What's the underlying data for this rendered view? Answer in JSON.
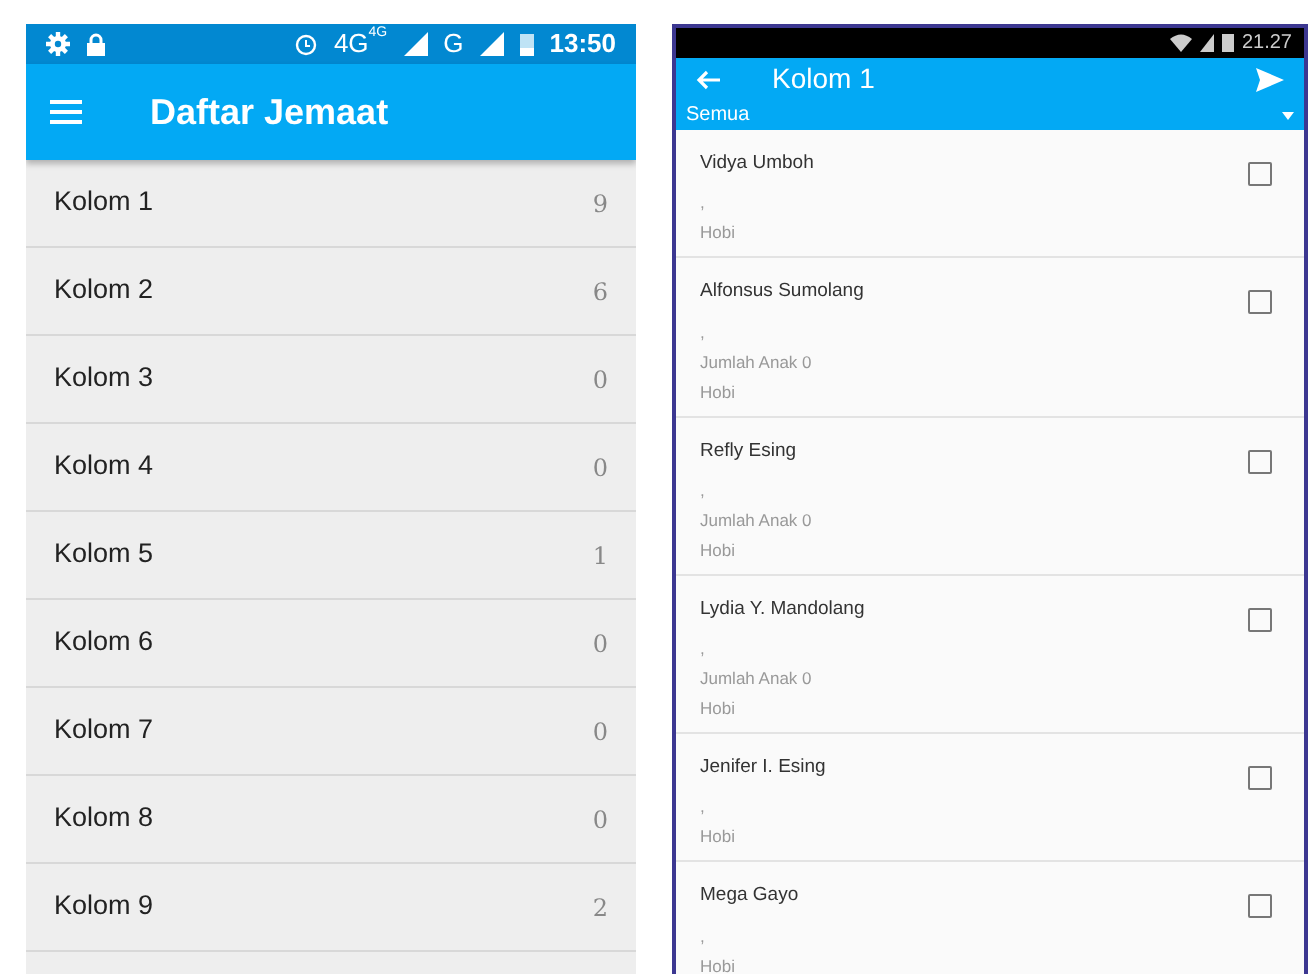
{
  "left_phone": {
    "status_bar": {
      "network": "4G",
      "network_sup": "4G",
      "network2": "G",
      "time": "13:50"
    },
    "app_bar": {
      "title": "Daftar Jemaat"
    },
    "items": [
      {
        "label": "Kolom 1",
        "count": "9"
      },
      {
        "label": "Kolom 2",
        "count": "6"
      },
      {
        "label": "Kolom 3",
        "count": "0"
      },
      {
        "label": "Kolom 4",
        "count": "0"
      },
      {
        "label": "Kolom 5",
        "count": "1"
      },
      {
        "label": "Kolom 6",
        "count": "0"
      },
      {
        "label": "Kolom 7",
        "count": "0"
      },
      {
        "label": "Kolom 8",
        "count": "0"
      },
      {
        "label": "Kolom 9",
        "count": "2"
      }
    ]
  },
  "right_phone": {
    "status_bar": {
      "time": "21.27"
    },
    "app_bar": {
      "title": "Kolom 1"
    },
    "filter": {
      "value": "Semua"
    },
    "members": [
      {
        "name": "Vidya Umboh",
        "details": [
          ",",
          "Hobi"
        ],
        "checked": false
      },
      {
        "name": "Alfonsus Sumolang",
        "details": [
          ",",
          "Jumlah Anak 0",
          "Hobi"
        ],
        "checked": false
      },
      {
        "name": "Refly Esing",
        "details": [
          ",",
          "Jumlah Anak 0",
          "Hobi"
        ],
        "checked": false
      },
      {
        "name": "Lydia Y. Mandolang",
        "details": [
          ",",
          "Jumlah Anak 0",
          "Hobi"
        ],
        "checked": false
      },
      {
        "name": "Jenifer I. Esing",
        "details": [
          ",",
          "Hobi"
        ],
        "checked": false
      },
      {
        "name": "Mega Gayo",
        "details": [
          ",",
          "Hobi"
        ],
        "checked": false
      }
    ]
  }
}
